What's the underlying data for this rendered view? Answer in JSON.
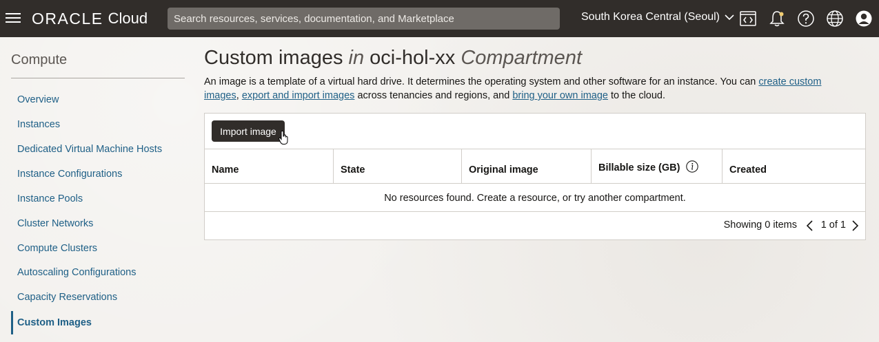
{
  "header": {
    "brand": "ORACLE",
    "product": "Cloud",
    "search_placeholder": "Search resources, services, documentation, and Marketplace",
    "region": "South Korea Central (Seoul)",
    "icons": [
      "menu-icon",
      "code-editor-icon",
      "bell-icon",
      "help-icon",
      "globe-icon",
      "user-icon"
    ]
  },
  "sidebar": {
    "title": "Compute",
    "items": [
      {
        "label": "Overview"
      },
      {
        "label": "Instances"
      },
      {
        "label": "Dedicated Virtual Machine Hosts"
      },
      {
        "label": "Instance Configurations"
      },
      {
        "label": "Instance Pools"
      },
      {
        "label": "Cluster Networks"
      },
      {
        "label": "Compute Clusters"
      },
      {
        "label": "Autoscaling Configurations"
      },
      {
        "label": "Capacity Reservations"
      },
      {
        "label": "Custom Images",
        "active": true
      }
    ]
  },
  "main": {
    "title_main": "Custom images",
    "title_in": "in",
    "title_compartment": "oci-hol-xx",
    "title_suffix": "Compartment",
    "desc_1": "An image is a template of a virtual hard drive. It determines the operating system and other software for an instance. You can ",
    "link_create": "create custom images",
    "desc_2": ", ",
    "link_export": "export and import images",
    "desc_3": " across tenancies and regions, and ",
    "link_byoi": "bring your own image",
    "desc_4": " to the cloud.",
    "import_button": "Import image",
    "columns": [
      "Name",
      "State",
      "Original image",
      "Billable size (GB)",
      "Created"
    ],
    "empty_message": "No resources found. Create a resource, or try another compartment.",
    "showing": "Showing 0 items",
    "pagination": "1 of 1"
  },
  "colors": {
    "header_bg": "#312d2a",
    "link": "#1e5f86",
    "button_bg": "#312d2a"
  }
}
